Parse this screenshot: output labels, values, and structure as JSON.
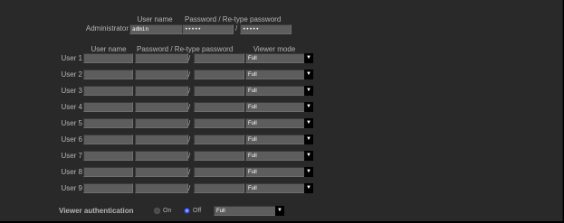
{
  "admin": {
    "label": "Administrator",
    "user_name_header": "User name",
    "password_header": "Password / Re-type password",
    "user_name_value": "admin",
    "password_value": "•••••",
    "retype_value": "•••••",
    "slash": "/"
  },
  "users_header": {
    "user_name": "User name",
    "password": "Password / Re-type password",
    "viewer_mode": "Viewer mode"
  },
  "users": [
    {
      "label": "User 1",
      "user_name": "",
      "password": "",
      "retype": "",
      "slash": "/",
      "viewer_mode": "Full"
    },
    {
      "label": "User 2",
      "user_name": "",
      "password": "",
      "retype": "",
      "slash": "/",
      "viewer_mode": "Full"
    },
    {
      "label": "User 3",
      "user_name": "",
      "password": "",
      "retype": "",
      "slash": "/",
      "viewer_mode": "Full"
    },
    {
      "label": "User 4",
      "user_name": "",
      "password": "",
      "retype": "",
      "slash": "/",
      "viewer_mode": "Full"
    },
    {
      "label": "User 5",
      "user_name": "",
      "password": "",
      "retype": "",
      "slash": "/",
      "viewer_mode": "Full"
    },
    {
      "label": "User 6",
      "user_name": "",
      "password": "",
      "retype": "",
      "slash": "/",
      "viewer_mode": "Full"
    },
    {
      "label": "User 7",
      "user_name": "",
      "password": "",
      "retype": "",
      "slash": "/",
      "viewer_mode": "Full"
    },
    {
      "label": "User 8",
      "user_name": "",
      "password": "",
      "retype": "",
      "slash": "/",
      "viewer_mode": "Full"
    },
    {
      "label": "User 9",
      "user_name": "",
      "password": "",
      "retype": "",
      "slash": "/",
      "viewer_mode": "Full"
    }
  ],
  "dropdown_arrow": "▼",
  "viewer_auth": {
    "label": "Viewer authentication",
    "on_label": "On",
    "off_label": "Off",
    "selected": "Off",
    "mode_value": "Full"
  },
  "colors": {
    "background": "#292929",
    "field": "#5d5d5d",
    "text": "#b4b4b4",
    "radio_selected": "#5f7cff"
  }
}
